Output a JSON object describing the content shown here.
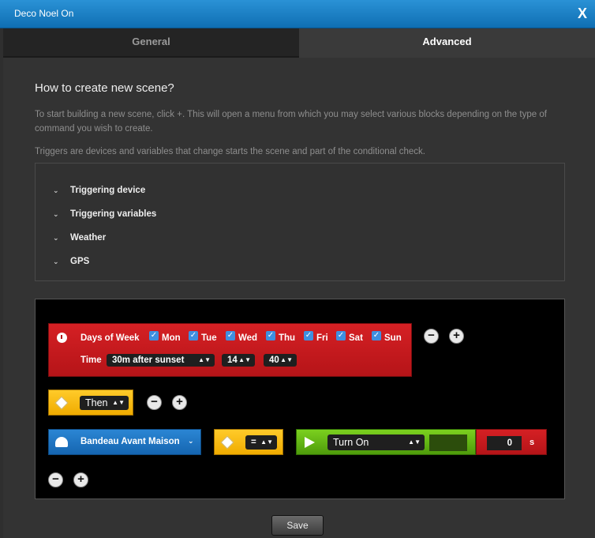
{
  "window": {
    "title": "Deco Noel On",
    "close": "X"
  },
  "tabs": {
    "general": "General",
    "advanced": "Advanced"
  },
  "help": {
    "heading": "How to create new scene?",
    "para1": "To start building a new scene, click +. This will open a menu from which you may select various blocks depending on the type of command you wish to create.",
    "para2": "Triggers are devices and variables that change starts the scene and part of the conditional check."
  },
  "categories": [
    "Triggering device",
    "Triggering variables",
    "Weather",
    "GPS"
  ],
  "schedule": {
    "days_label": "Days of Week",
    "days": [
      "Mon",
      "Tue",
      "Wed",
      "Thu",
      "Fri",
      "Sat",
      "Sun"
    ],
    "time_label": "Time",
    "time_value": "30m after sunset",
    "hour": "14",
    "minute": "40"
  },
  "then": {
    "value": "Then"
  },
  "device": {
    "name": "Bandeau Avant Maison"
  },
  "operator": {
    "value": "="
  },
  "action": {
    "value": "Turn On"
  },
  "delay": {
    "value": "0",
    "unit": "s"
  },
  "buttons": {
    "minus": "−",
    "plus": "+",
    "save": "Save",
    "check": "✓"
  },
  "colors": {
    "accent": "#1f7fc9",
    "trigger_red": "#c91b1f",
    "condition_yellow": "#f8bb10",
    "action_green": "#66b816"
  }
}
